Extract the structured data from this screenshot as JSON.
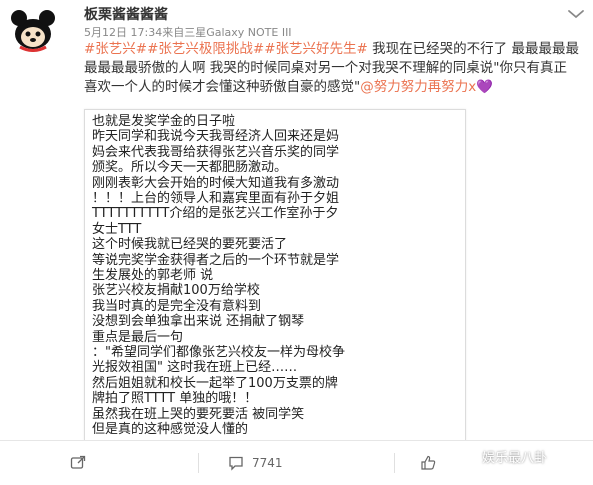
{
  "user": {
    "name": "板栗酱酱酱酱",
    "meta": "5月12日 17:34来自三星Galaxy NOTE III"
  },
  "post": {
    "tags": "#张艺兴##张艺兴极限挑战##张艺兴好先生#",
    "line1_text": " 我现在已经哭的不行了 最最最最最",
    "line2": "最最最最骄傲的人啊 我哭的时候同桌对另一个对我哭不理解的同桌说\"你只有真正",
    "line3_text": "喜欢一个人的时候才会懂这种骄傲自豪的感觉\"",
    "mention": "@努力努力再努力x",
    "heart": "💜"
  },
  "note_lines": [
    "也就是发奖学金的日子啦",
    "昨天同学和我说今天我哥经济人回来还是妈",
    "妈会来代表我哥给获得张艺兴音乐奖的同学",
    "颁奖。所以今天一天都肥肠激动。",
    "刚刚表彰大会开始的时候大知道我有多激动",
    "！！！上台的领导人和嘉宾里面有孙于夕姐",
    "TTTTTTTTTT介绍的是张艺兴工作室孙于夕",
    "女士TTT",
    "这个时候我就已经哭的要死要活了",
    "等说完奖学金获得者之后的一个环节就是学",
    "生发展处的郭老师 说",
    "张艺兴校友捐献100万给学校",
    "我当时真的是完全没有意料到",
    "没想到会单独拿出来说 还捐献了钢琴",
    "重点是最后一句",
    "：\"希望同学们都像张艺兴校友一样为母校争",
    "光报效祖国\" 这时我在班上已经……",
    "然后姐姐就和校长一起举了100万支票的牌",
    "牌拍了照TTTT 单独的哦！！",
    "虽然我在班上哭的要死要活 被同学笑",
    "但是真的这种感觉没人懂的"
  ],
  "footer": {
    "repost_count": "",
    "comment_count": "7741",
    "like_count": ""
  },
  "watermark": "娱乐最八卦",
  "colors": {
    "accent": "#eb7350",
    "text": "#333333",
    "meta": "#888888",
    "heart": "#9b59d0"
  },
  "icons": {
    "avatar": "cartoon-avatar",
    "chevron": "chevron-down-icon",
    "repost": "share-icon",
    "comment": "comment-icon",
    "like": "thumbs-up-icon",
    "wechat": "wechat-icon"
  }
}
